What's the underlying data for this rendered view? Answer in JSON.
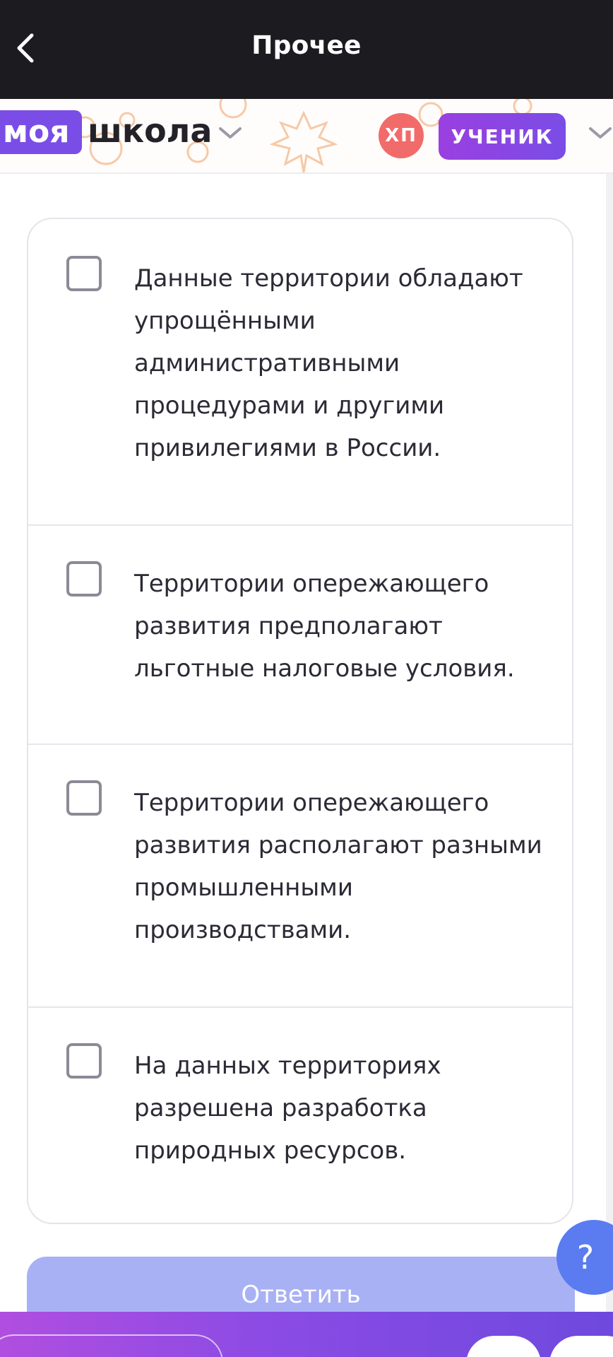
{
  "topbar": {
    "title": "Прочее",
    "back_icon": "chevron-left-icon"
  },
  "school_header": {
    "logo_part1": "моя",
    "logo_part2": "школа",
    "avatar_initials": "ХП",
    "role_badge": "УЧЕНИК",
    "accent_color": "#7a4de6",
    "avatar_color": "#f26b6b"
  },
  "options": [
    {
      "text": "Данные территории обладают упрощёнными административными процедурами и другими привилегиями в России.",
      "checked": false
    },
    {
      "text": "Территории опережающего развития предполагают льготные налоговые условия.",
      "checked": false
    },
    {
      "text": "Территории опережающего развития располагают разными промышленными производствами.",
      "checked": false
    },
    {
      "text": "На данных территориях разрешена разработка природных ресурсов.",
      "checked": false
    }
  ],
  "answer_button": {
    "label": "Ответить",
    "color": "#a9b1f5"
  },
  "help_button": {
    "label": "?",
    "color": "#5a7cf0"
  }
}
